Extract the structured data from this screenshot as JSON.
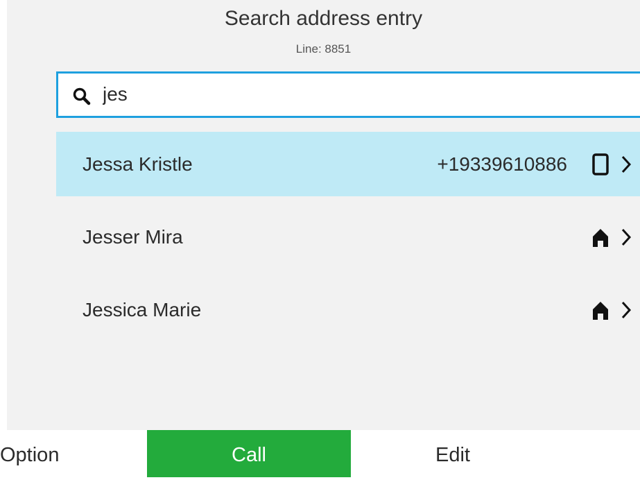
{
  "header": {
    "title": "Search address entry",
    "line_label": "Line: 8851"
  },
  "search": {
    "icon": "search-icon",
    "value": "jes"
  },
  "results": [
    {
      "name": "Jessa Kristle",
      "number": "+19339610886",
      "type_icon": "mobile-phone-icon",
      "selected": true
    },
    {
      "name": "Jesser Mira",
      "number": "",
      "type_icon": "home-icon",
      "selected": false
    },
    {
      "name": "Jessica Marie",
      "number": "",
      "type_icon": "home-icon",
      "selected": false
    }
  ],
  "softkeys": {
    "option": "Option",
    "call": "Call",
    "edit": "Edit"
  },
  "colors": {
    "accent_border": "#1ea0df",
    "selected_row": "#bfeaf6",
    "call_button": "#23ab3c",
    "screen_background": "#f2f2f2"
  }
}
